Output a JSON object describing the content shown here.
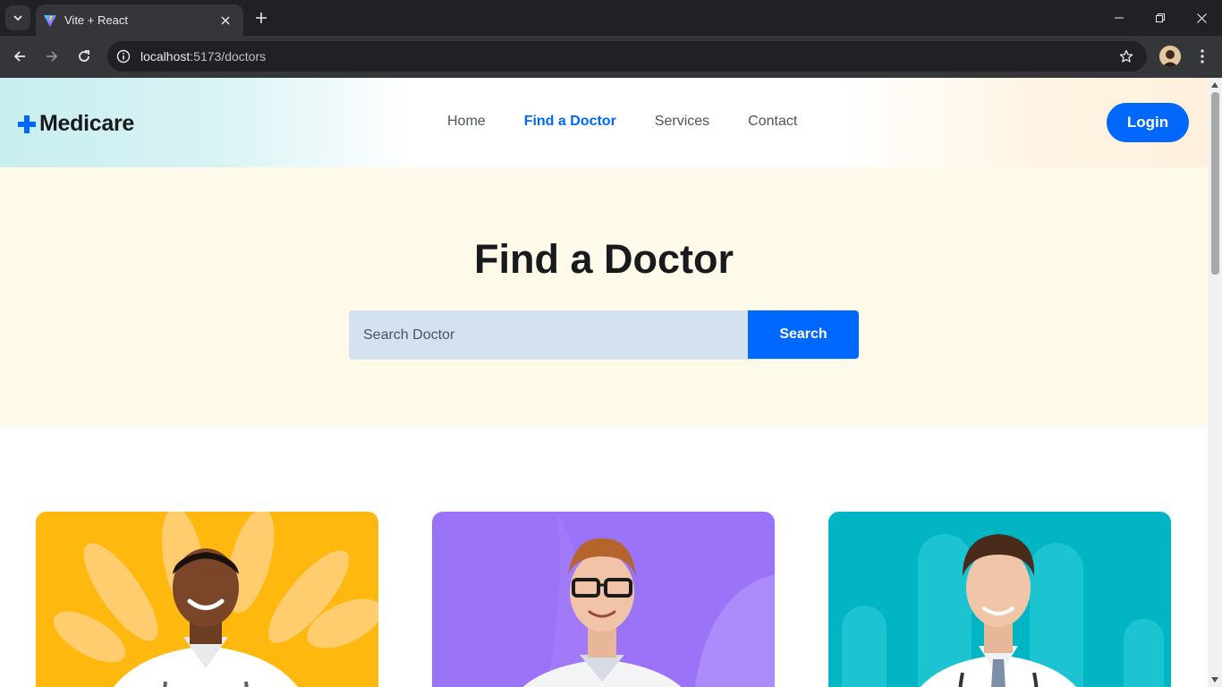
{
  "browser": {
    "tab_title": "Vite + React",
    "url_host": "localhost",
    "url_path": ":5173/doctors"
  },
  "header": {
    "logo_text": "Medicare",
    "nav": [
      {
        "label": "Home",
        "active": false
      },
      {
        "label": "Find a Doctor",
        "active": true
      },
      {
        "label": "Services",
        "active": false
      },
      {
        "label": "Contact",
        "active": false
      }
    ],
    "login_label": "Login"
  },
  "hero": {
    "title": "Find a Doctor",
    "search_placeholder": "Search Doctor",
    "search_button": "Search"
  },
  "doctors": [
    {
      "background": "#ffb80d",
      "accent": "#ffd07f"
    },
    {
      "background": "#9a73f8",
      "accent": "#ac8cfb"
    },
    {
      "background": "#01b5c5",
      "accent": "#1cc4d2"
    }
  ],
  "colors": {
    "primary": "#0067ff",
    "heading": "#181a1e",
    "text": "#4e545f",
    "hero_bg": "#fff9ea",
    "search_bg": "#d4e1ef"
  }
}
